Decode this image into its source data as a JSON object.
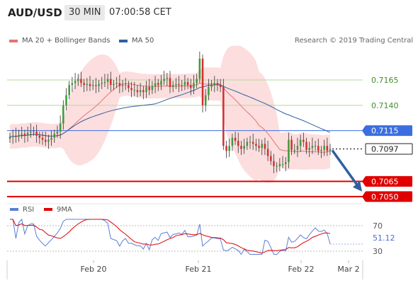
{
  "header": {
    "symbol": "AUD/USD",
    "timeframe": "30 MIN",
    "time": "07:00:58 CET"
  },
  "legend": {
    "ma20": "MA 20 + Bollinger Bands",
    "ma50": "MA 50",
    "rsi": "RSI",
    "ma9": "9MA",
    "copyright": "Research © 2019 Trading Central"
  },
  "colors": {
    "ma20": "#e57373",
    "bollinger_fill": "#fbd3d3",
    "ma50": "#2f5fa0",
    "bull_candle": "#3f9a3a",
    "bear_candle": "#d32f2f",
    "resistance_lines": "#b5d99c",
    "pivot_line": "#3b6fe0",
    "support_lines": "#e00000",
    "current_price_box": "#222222",
    "forecast_arrow": "#2f5fa0",
    "rsi_line": "#5b7fd6",
    "rsi_ma9": "#e00000"
  },
  "chart_data": {
    "type": "candlestick",
    "title": "AUD/USD",
    "timeframe": "30 MIN",
    "x_tick_labels": [
      "Feb 20",
      "Feb 21",
      "Feb 22",
      "Mar 2"
    ],
    "ylim": [
      0.7045,
      0.7195
    ],
    "levels": [
      {
        "name": "resistance 2",
        "value": 0.7165,
        "label": "0.7165"
      },
      {
        "name": "resistance 1",
        "value": 0.714,
        "label": "0.7140"
      },
      {
        "name": "pivot",
        "value": 0.7115,
        "label": "0.7115"
      },
      {
        "name": "last",
        "value": 0.7097,
        "label": "0.7097"
      },
      {
        "name": "support 1",
        "value": 0.7065,
        "label": "0.7065"
      },
      {
        "name": "support 2",
        "value": 0.705,
        "label": "0.7050"
      }
    ],
    "close": [
      0.7109,
      0.711,
      0.7109,
      0.7111,
      0.7112,
      0.711,
      0.7113,
      0.7114,
      0.7114,
      0.711,
      0.7108,
      0.7106,
      0.7104,
      0.7106,
      0.7108,
      0.7112,
      0.7114,
      0.7122,
      0.714,
      0.715,
      0.716,
      0.7162,
      0.7164,
      0.7166,
      0.7162,
      0.716,
      0.7161,
      0.7159,
      0.716,
      0.7159,
      0.7161,
      0.7162,
      0.7163,
      0.7166,
      0.716,
      0.7161,
      0.7162,
      0.7159,
      0.716,
      0.716,
      0.7157,
      0.7155,
      0.7155,
      0.7153,
      0.7155,
      0.7153,
      0.7158,
      0.7155,
      0.7159,
      0.7162,
      0.716,
      0.7164,
      0.7166,
      0.7167,
      0.7158,
      0.716,
      0.7161,
      0.716,
      0.716,
      0.7163,
      0.716,
      0.7157,
      0.7162,
      0.7166,
      0.7186,
      0.714,
      0.715,
      0.7158,
      0.716,
      0.7162,
      0.716,
      0.7158,
      0.71,
      0.7095,
      0.71,
      0.7108,
      0.7105,
      0.71,
      0.7097,
      0.71,
      0.7104,
      0.7104,
      0.7102,
      0.71,
      0.7098,
      0.7102,
      0.7097,
      0.709,
      0.7085,
      0.708,
      0.708,
      0.7082,
      0.7082,
      0.7084,
      0.7106,
      0.7096,
      0.7096,
      0.71,
      0.7106,
      0.7104,
      0.7096,
      0.7098,
      0.71,
      0.71,
      0.7095,
      0.7096,
      0.71,
      0.7095,
      0.7097
    ],
    "rsi": {
      "ylim": [
        20,
        80
      ],
      "tick_labels": [
        "70",
        "30"
      ],
      "current_label": "51.12",
      "ma9_period_label": "9MA"
    }
  }
}
